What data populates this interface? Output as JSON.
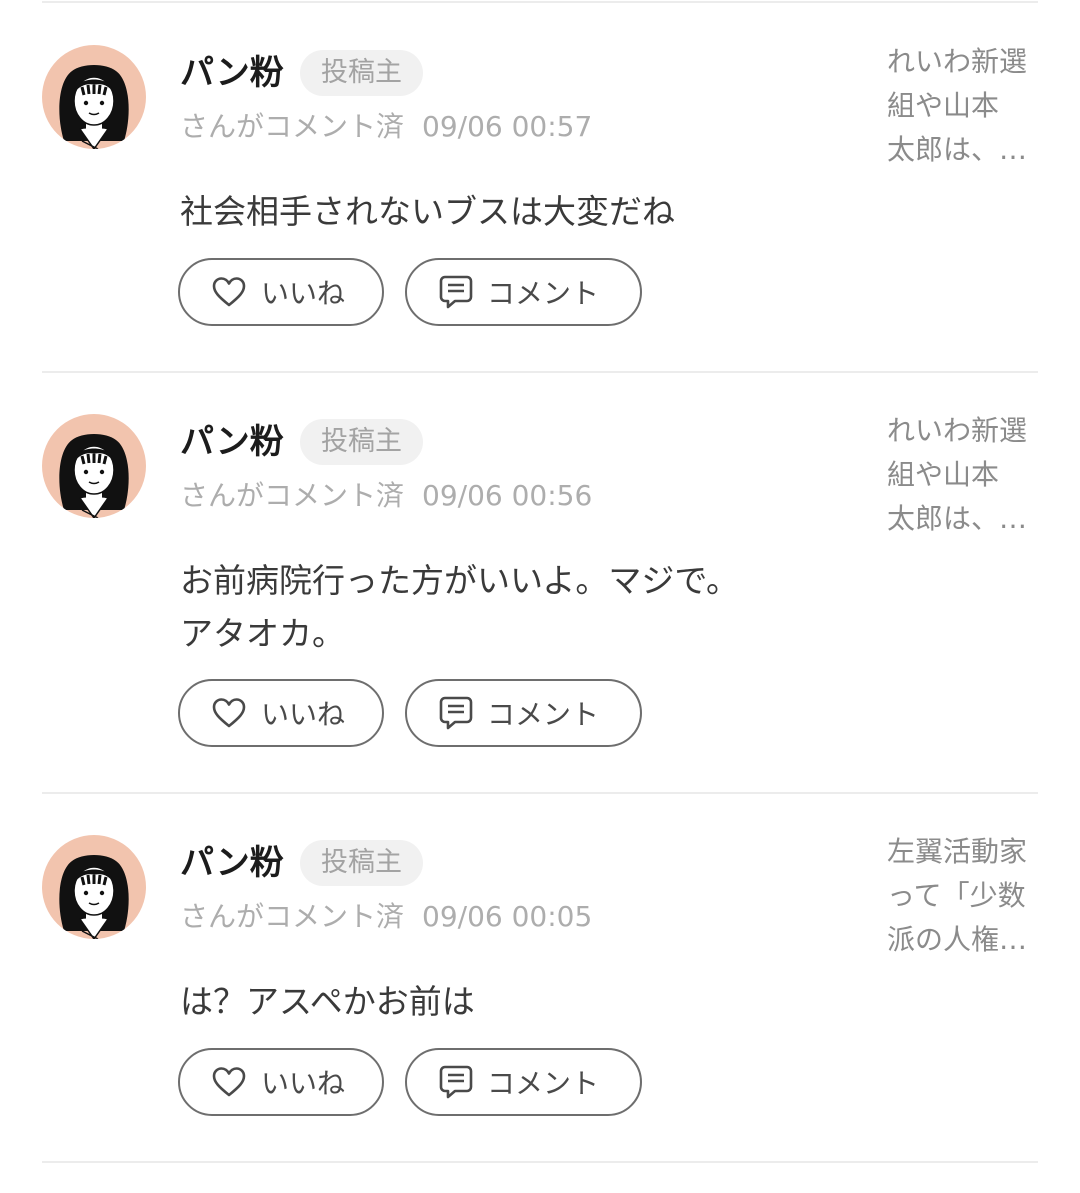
{
  "colors": {
    "avatar_bg": "#f2c4ae",
    "badge_bg": "#f1f1f1",
    "divider": "#ececec",
    "button_border": "#6e6e6e"
  },
  "comments": [
    {
      "author": "パン粉",
      "badge": "投稿主",
      "action_text": "さんがコメント済",
      "timestamp": "09/06 00:57",
      "body_lines": [
        "社会相手されないブスは大変だね"
      ],
      "post_title_lines": [
        "れいわ新選",
        "組や山本",
        "太郎は、…"
      ],
      "like_label": "いいね",
      "comment_label": "コメント"
    },
    {
      "author": "パン粉",
      "badge": "投稿主",
      "action_text": "さんがコメント済",
      "timestamp": "09/06 00:56",
      "body_lines": [
        "お前病院行った方がいいよ。マジで。",
        "アタオカ。"
      ],
      "post_title_lines": [
        "れいわ新選",
        "組や山本",
        "太郎は、…"
      ],
      "like_label": "いいね",
      "comment_label": "コメント"
    },
    {
      "author": "パン粉",
      "badge": "投稿主",
      "action_text": "さんがコメント済",
      "timestamp": "09/06 00:05",
      "body_lines": [
        "は？アスペかお前は"
      ],
      "post_title_lines": [
        "左翼活動家",
        "って「少数",
        "派の人権…"
      ],
      "like_label": "いいね",
      "comment_label": "コメント"
    }
  ]
}
